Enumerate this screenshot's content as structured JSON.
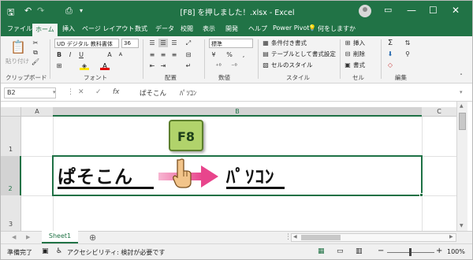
{
  "titlebar": {
    "title": "[F8] を押しました！.xlsx  -  Excel",
    "quick_access": {
      "save_icon": "save-icon",
      "undo_icon": "undo-icon",
      "redo_icon": "redo-icon",
      "preview_icon": "print-preview-icon",
      "customize": "▾"
    },
    "buttons": {
      "ribbon_display": "▭",
      "minimize": "—",
      "maximize": "☐",
      "close": "✕"
    }
  },
  "tabs": [
    "ファイル",
    "ホーム",
    "挿入",
    "ページ レイアウト",
    "数式",
    "データ",
    "校閲",
    "表示",
    "開発",
    "ヘルプ",
    "Power Pivot"
  ],
  "active_tab": "ホーム",
  "tell_me": "何をしますか",
  "ribbon": {
    "clipboard": {
      "label": "クリップボード",
      "paste": "貼り付け"
    },
    "font": {
      "label": "フォント",
      "name": "UD デジタル 教科書体",
      "size": "36",
      "bold": "B",
      "italic": "I",
      "underline": "U",
      "grow": "A",
      "shrink": "A",
      "font_color": "A"
    },
    "alignment": {
      "label": "配置"
    },
    "number": {
      "label": "数値",
      "format": "標準",
      "percent": "%",
      "comma": ","
    },
    "styles": {
      "label": "スタイル",
      "conditional": "条件付き書式",
      "table": "テーブルとして書式設定",
      "cell_styles": "セルのスタイル"
    },
    "cells": {
      "label": "セル",
      "insert": "挿入",
      "delete": "削除",
      "format": "書式"
    },
    "editing": {
      "label": "編集",
      "sum": "Σ",
      "sort": "⇅",
      "find": "⚲"
    }
  },
  "formula_bar": {
    "name_box": "B2",
    "cancel": "✕",
    "enter": "✓",
    "fx": "fx",
    "content": "ぱそこん　　ﾊﾟｿｺﾝ"
  },
  "grid": {
    "columns": [
      "A",
      "B",
      "C"
    ],
    "rows": [
      "1",
      "2",
      "3"
    ],
    "cell_b2_left": "ぱそこん",
    "cell_b2_right": "ﾊﾟｿｺﾝ",
    "key_label": "F8"
  },
  "sheet_tabs": {
    "active": "Sheet1",
    "add": "⊕",
    "dots": "⋮"
  },
  "status": {
    "ready": "準備完了",
    "accessibility": "アクセシビリティ: 検討が必要です",
    "zoom": "100%",
    "zoom_minus": "−",
    "zoom_plus": "+"
  },
  "colors": {
    "excel_green": "#217346",
    "key_green": "#b1d36b",
    "arrow_pink": "#e8458c",
    "selection_green": "#1e7145"
  }
}
